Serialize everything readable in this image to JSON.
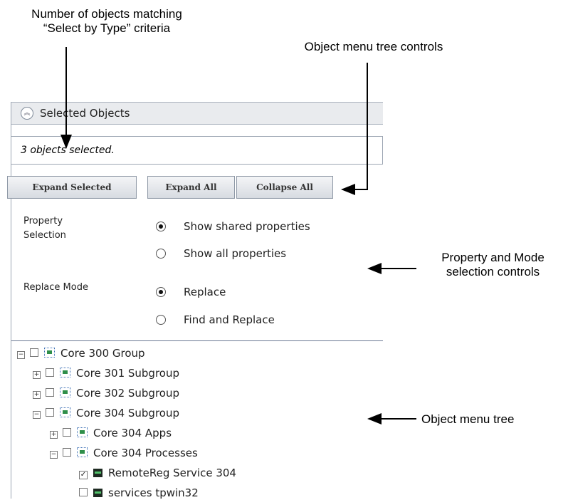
{
  "annotations": {
    "number_of_objects": [
      "Number of objects matching",
      "“Select by Type” criteria"
    ],
    "tree_controls": "Object menu tree controls",
    "property_mode": [
      "Property and Mode",
      "selection controls"
    ],
    "menu_tree": "Object menu tree"
  },
  "panel": {
    "title": "Selected Objects",
    "count_text": "3 objects selected.",
    "buttons": {
      "expand_selected": "Expand Selected",
      "expand_all": "Expand All",
      "collapse_all": "Collapse All"
    },
    "property_selection": {
      "label": [
        "Property",
        "Selection"
      ],
      "options": [
        "Show shared properties",
        "Show all properties"
      ],
      "selected": "Show shared properties"
    },
    "replace_mode": {
      "label": "Replace Mode",
      "options": [
        "Replace",
        "Find and Replace"
      ],
      "selected": "Replace"
    },
    "tree": [
      {
        "label": "Core 300 Group",
        "toggle": "minus",
        "checked": false,
        "icon": "group-icon"
      },
      {
        "label": "Core 301 Subgroup",
        "toggle": "plus",
        "checked": false,
        "icon": "group-icon"
      },
      {
        "label": "Core 302 Subgroup",
        "toggle": "plus",
        "checked": false,
        "icon": "group-icon"
      },
      {
        "label": "Core 304 Subgroup",
        "toggle": "minus",
        "checked": false,
        "icon": "group-icon"
      },
      {
        "label": "Core 304 Apps",
        "toggle": "plus",
        "checked": false,
        "icon": "group-icon"
      },
      {
        "label": "Core 304 Processes",
        "toggle": "minus",
        "checked": false,
        "icon": "group-icon"
      },
      {
        "label": "RemoteReg Service 304",
        "toggle": "none",
        "checked": true,
        "icon": "monitor-icon"
      },
      {
        "label": "services tpwin32",
        "toggle": "none",
        "checked": false,
        "icon": "monitor-icon"
      }
    ]
  }
}
